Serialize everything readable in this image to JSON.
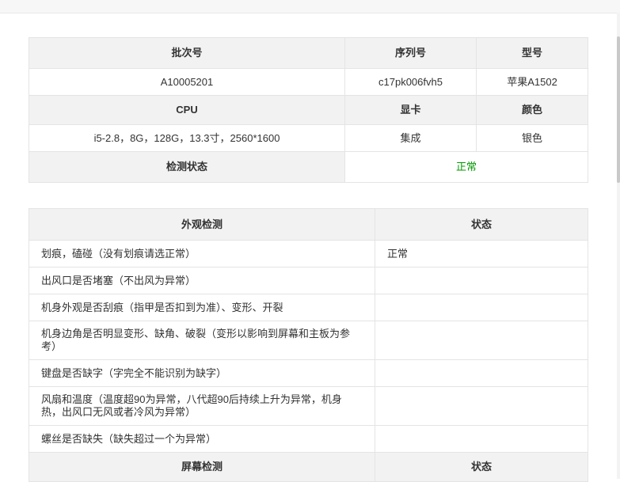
{
  "info_table": {
    "headers": [
      "批次号",
      "序列号",
      "型号"
    ],
    "row1": [
      "A10005201",
      "c17pk006fvh5",
      "苹果A1502"
    ],
    "headers2": [
      "CPU",
      "显卡",
      "颜色"
    ],
    "row2": [
      "i5-2.8，8G，128G，13.3寸，2560*1600",
      "集成",
      "银色"
    ],
    "status_label": "检测状态",
    "status_value": "正常"
  },
  "appearance_table": {
    "header_item": "外观检测",
    "header_status": "状态",
    "rows": [
      {
        "item": "划痕，磕碰（没有划痕请选正常）",
        "status": "正常"
      },
      {
        "item": "出风口是否堵塞（不出风为异常）",
        "status": ""
      },
      {
        "item": "机身外观是否刮痕（指甲是否扣到为准）、变形、开裂",
        "status": ""
      },
      {
        "item": "机身边角是否明显变形、缺角、破裂（变形以影响到屏幕和主板为参考）",
        "status": ""
      },
      {
        "item": "键盘是否缺字（字完全不能识别为缺字）",
        "status": ""
      },
      {
        "item": "风扇和温度（温度超90为异常，八代超90后持续上升为异常，机身热，出风口无风或者冷风为异常）",
        "status": ""
      },
      {
        "item": "螺丝是否缺失（缺失超过一个为异常）",
        "status": ""
      }
    ],
    "screen_header_item": "屏幕检测",
    "screen_header_status": "状态"
  },
  "colors": {
    "header_bg": "#f2f2f2",
    "border": "#e4e4e4",
    "ok_green": "#009900"
  }
}
